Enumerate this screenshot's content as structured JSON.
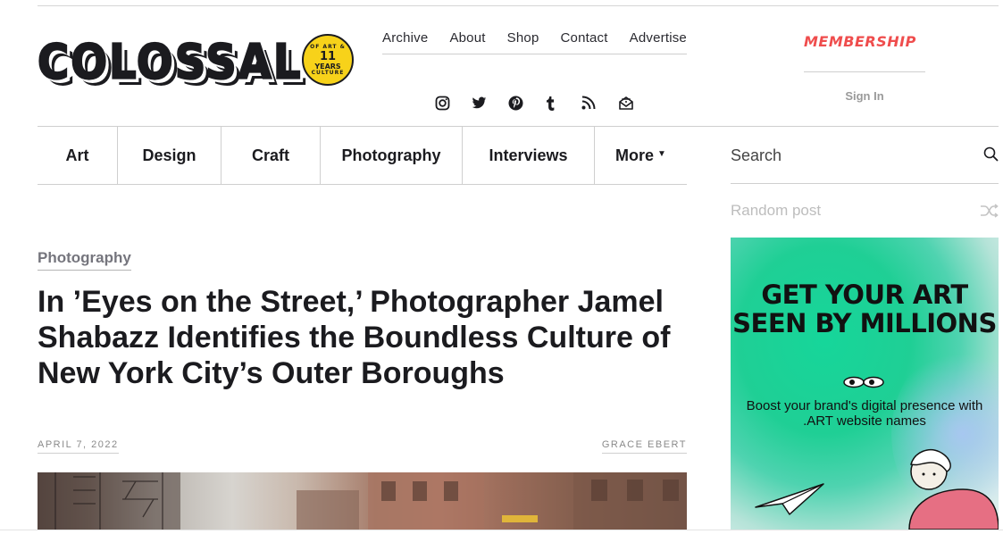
{
  "brand": {
    "logo_text": "COLOSSAL",
    "badge_top": "OF ART &",
    "badge_num": "11",
    "badge_years": "YEARS",
    "badge_bottom": "CULTURE"
  },
  "top_nav": [
    "Archive",
    "About",
    "Shop",
    "Contact",
    "Advertise"
  ],
  "social_icons": [
    "instagram-icon",
    "twitter-icon",
    "pinterest-icon",
    "tumblr-icon",
    "rss-icon",
    "newsletter-icon"
  ],
  "account": {
    "membership": "MEMBERSHIP",
    "sign_in": "Sign In"
  },
  "categories": [
    {
      "label": "Art"
    },
    {
      "label": "Design"
    },
    {
      "label": "Craft"
    },
    {
      "label": "Photography"
    },
    {
      "label": "Interviews"
    },
    {
      "label": "More"
    }
  ],
  "search": {
    "placeholder": "Search"
  },
  "random_post": {
    "label": "Random post"
  },
  "article": {
    "category": "Photography",
    "title": "In ’Eyes on the Street,’ Photographer Jamel Shabazz Identifies the Boundless Culture of New York City’s Outer Boroughs",
    "date": "APRIL 7, 2022",
    "author": "GRACE EBERT"
  },
  "ad": {
    "headline": "GET YOUR ART SEEN BY MILLIONS",
    "subtext": "Boost your brand's digital presence with .ART website names"
  },
  "colors": {
    "membership": "#ef4d4d",
    "badge": "#f7d21a",
    "text": "#1b1b1f",
    "ad_green": "#1fcf95"
  }
}
